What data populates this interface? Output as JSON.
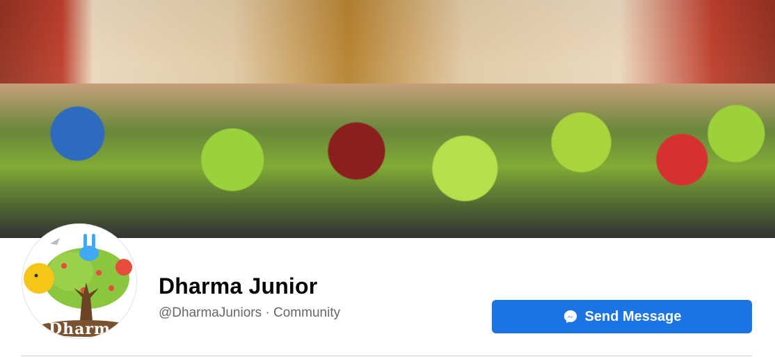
{
  "page": {
    "name": "Dharma Junior",
    "handle": "@DharmaJuniors",
    "separator": "·",
    "category": "Community"
  },
  "actions": {
    "send_message_label": "Send Message"
  },
  "avatar": {
    "logo_text": "Dharm"
  },
  "colors": {
    "primary_button": "#1b74e4",
    "name_text": "#050505",
    "secondary_text": "#65676b"
  },
  "icons": {
    "messenger": "messenger-icon"
  }
}
